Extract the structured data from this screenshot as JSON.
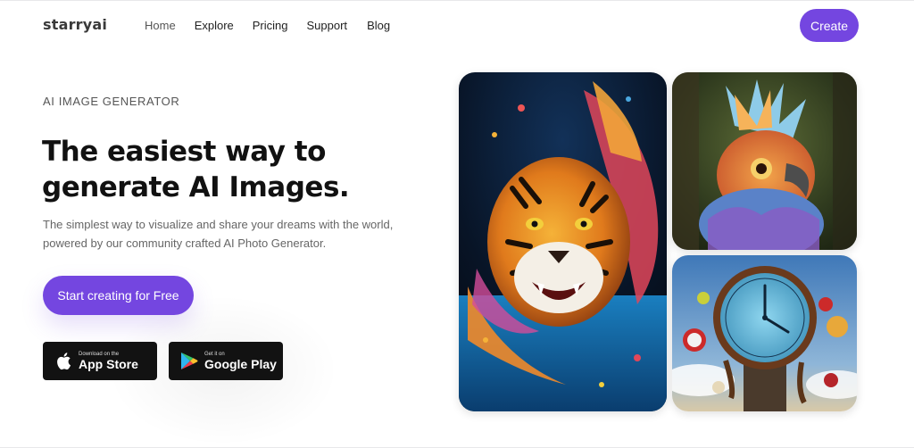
{
  "brand": {
    "logo": "starryai"
  },
  "nav": {
    "items": [
      {
        "label": "Home"
      },
      {
        "label": "Explore"
      },
      {
        "label": "Pricing"
      },
      {
        "label": "Support"
      },
      {
        "label": "Blog"
      }
    ],
    "create_label": "Create"
  },
  "hero": {
    "eyebrow": "AI IMAGE GENERATOR",
    "headline_line1": "The easiest way to",
    "headline_line2": "generate AI Images.",
    "subtitle": "The simplest way to visualize and share your dreams with the world, powered by our community crafted AI Photo Generator.",
    "cta_label": "Start creating for Free"
  },
  "stores": {
    "apple": {
      "small": "Download on the",
      "big": "App Store",
      "icon": "apple-icon"
    },
    "google": {
      "small": "Get it on",
      "big": "Google Play",
      "icon": "google-play-icon"
    }
  },
  "gallery": [
    {
      "name": "tiger-image"
    },
    {
      "name": "bird-image"
    },
    {
      "name": "clock-image"
    }
  ],
  "colors": {
    "accent": "#7446e0",
    "store_bg": "#121212"
  }
}
